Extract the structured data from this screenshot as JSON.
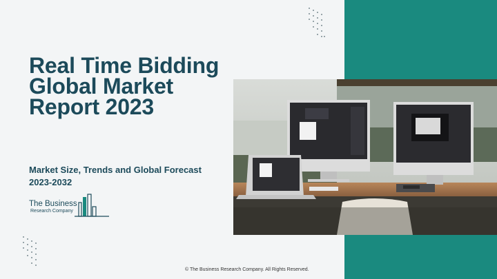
{
  "report": {
    "title": "Real Time Bidding Global Market Report 2023",
    "subtitle": "Market Size, Trends and Global Forecast 2023-2032"
  },
  "logo": {
    "line1": "The Business",
    "line2": "Research Company"
  },
  "footer": {
    "copyright": "© The Business Research Company. All Rights Reserved."
  },
  "colors": {
    "accent_teal": "#1a8a7f",
    "title_navy": "#1c4a5a",
    "background": "#f3f5f6"
  },
  "icons": {
    "logo_mark": "bar-chart-building-icon",
    "dot_grid": "dot-grid-pattern"
  }
}
